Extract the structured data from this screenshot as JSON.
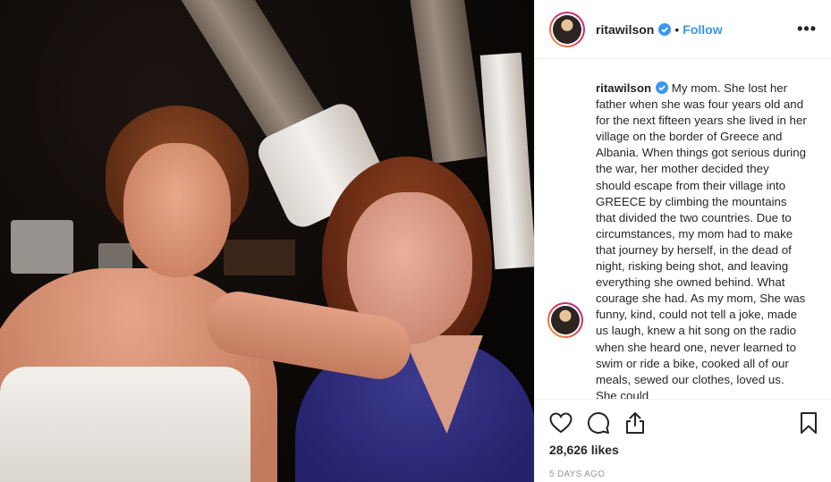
{
  "post": {
    "username": "ritawilson",
    "follow_label": "Follow",
    "separator": "•",
    "more_label": "•••",
    "caption_username": "ritawilson",
    "caption_text": "My mom. She lost her father when she was four years old and for the next fifteen years she lived in her village on the border of Greece and Albania. When things got serious during the war, her mother decided they should escape from their village into GREECE by climbing the mountains that divided the two countries. Due to circumstances, my mom had to make that journey by herself, in the dead of night, risking being shot, and leaving everything she owned behind. What courage she had. As my mom, She was funny, kind, could not tell a joke, made us laugh, knew a hit song on the radio when she heard one, never learned to swim or ride a bike, cooked all of our meals, sewed our clothes, loved us. She could",
    "likes": "28,626 likes",
    "timestamp": "5 DAYS AGO"
  },
  "colors": {
    "accent": "#3897f0",
    "text": "#262626",
    "muted": "#999999"
  },
  "icons": [
    "verified-badge-icon",
    "more-options-icon",
    "heart-icon",
    "comment-icon",
    "share-icon",
    "bookmark-icon"
  ]
}
